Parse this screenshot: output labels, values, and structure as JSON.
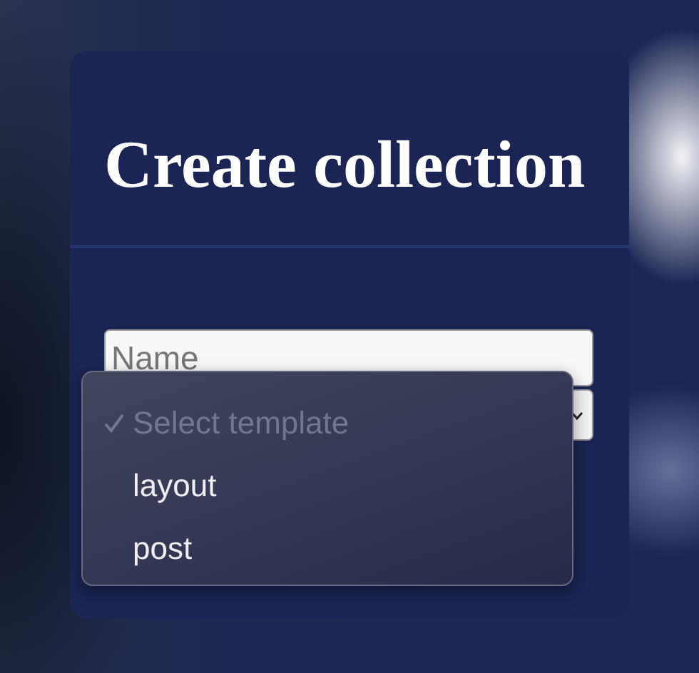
{
  "dialog": {
    "title": "Create collection",
    "name_field": {
      "placeholder": "Name"
    },
    "template_select": {
      "open": true,
      "options": [
        {
          "label": "Select template",
          "selected": true,
          "disabled": true
        },
        {
          "label": "layout",
          "selected": false,
          "disabled": false
        },
        {
          "label": "post",
          "selected": false,
          "disabled": false
        }
      ]
    }
  }
}
